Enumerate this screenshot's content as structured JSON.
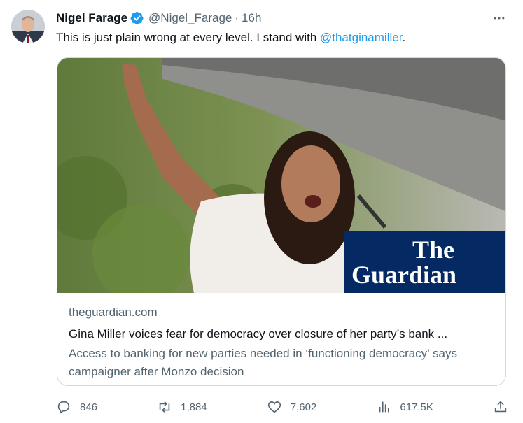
{
  "author": {
    "name": "Nigel Farage",
    "handle": "@Nigel_Farage",
    "separator": "·",
    "time": "16h"
  },
  "tweet": {
    "text_before": "This is just plain wrong at every level. I stand with ",
    "mention": "@thatginamiller",
    "text_after": "."
  },
  "card": {
    "domain": "theguardian.com",
    "headline": "Gina Miller voices fear for democracy over closure of her party’s bank ...",
    "description": "Access to banking for new parties needed in ‘functioning democracy’ says campaigner after Monzo decision",
    "logo_line1": "The",
    "logo_line2": "Guardian"
  },
  "actions": {
    "replies": "846",
    "reposts": "1,884",
    "likes": "7,602",
    "views": "617.5K"
  },
  "colors": {
    "accent": "#1d9bf0",
    "muted": "#536471",
    "guardian_blue": "#052962"
  },
  "icons": [
    "verified-badge-icon",
    "more-icon",
    "reply-icon",
    "repost-icon",
    "like-icon",
    "views-icon",
    "share-icon"
  ]
}
